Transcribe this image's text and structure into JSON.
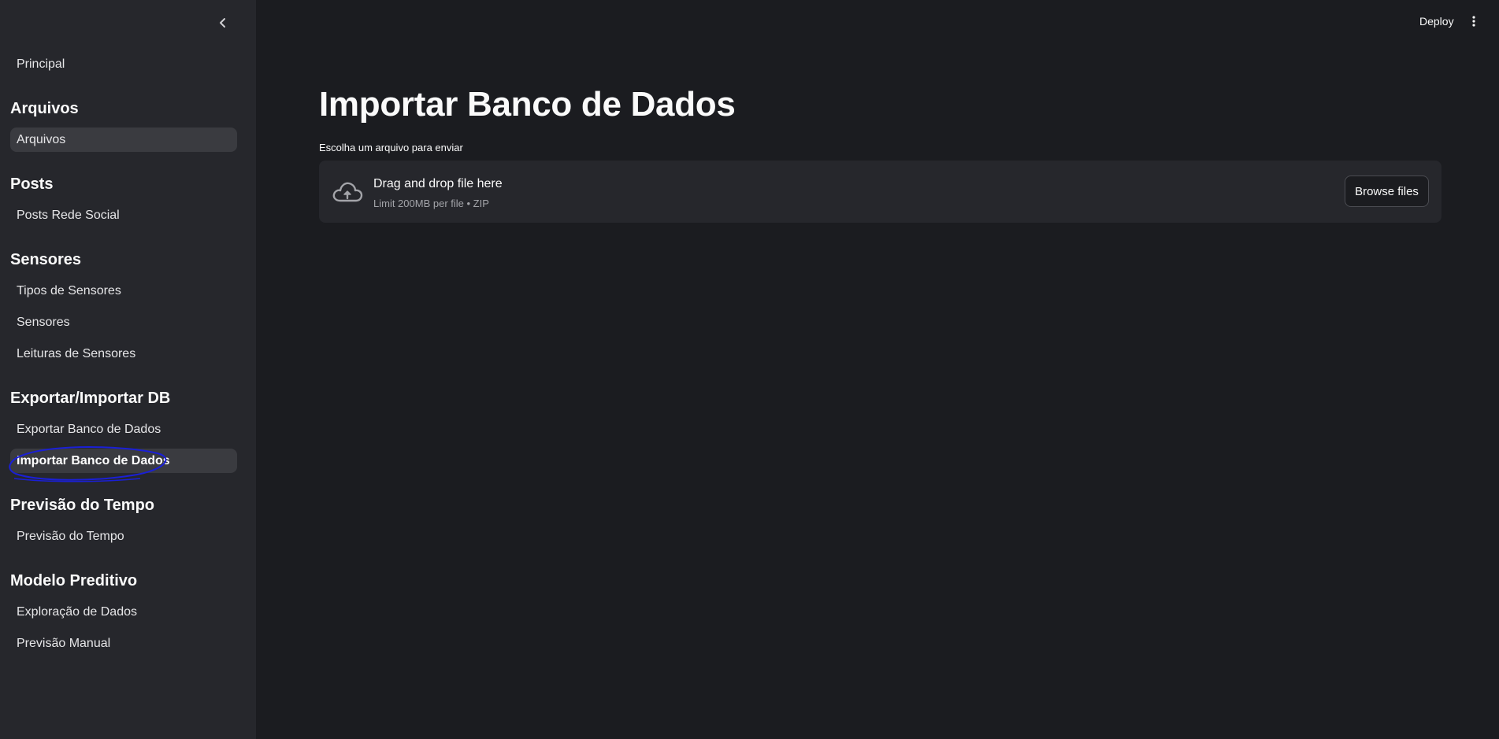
{
  "sidebar": {
    "top_item": "Principal",
    "sections": [
      {
        "title": "Arquivos",
        "items": [
          "Arquivos"
        ]
      },
      {
        "title": "Posts",
        "items": [
          "Posts Rede Social"
        ]
      },
      {
        "title": "Sensores",
        "items": [
          "Tipos de Sensores",
          "Sensores",
          "Leituras de Sensores"
        ]
      },
      {
        "title": "Exportar/Importar DB",
        "items": [
          "Exportar Banco de Dados",
          "Importar Banco de Dados"
        ]
      },
      {
        "title": "Previsão do Tempo",
        "items": [
          "Previsão do Tempo"
        ]
      },
      {
        "title": "Modelo Preditivo",
        "items": [
          "Exploração de Dados",
          "Previsão Manual"
        ]
      }
    ],
    "active_item": "Importar Banco de Dados",
    "highlight_color": "#1a1fd6"
  },
  "header": {
    "deploy_label": "Deploy",
    "menu_icon": "kebab-menu-icon"
  },
  "main": {
    "title": "Importar Banco de Dados",
    "uploader": {
      "label": "Escolha um arquivo para enviar",
      "dropzone_title": "Drag and drop file here",
      "dropzone_subtitle": "Limit 200MB per file • ZIP",
      "browse_label": "Browse files",
      "icon": "cloud-upload-icon"
    }
  },
  "colors": {
    "background": "#1b1c20",
    "sidebar": "#26272c",
    "active_item_bg": "#3a3b40"
  }
}
